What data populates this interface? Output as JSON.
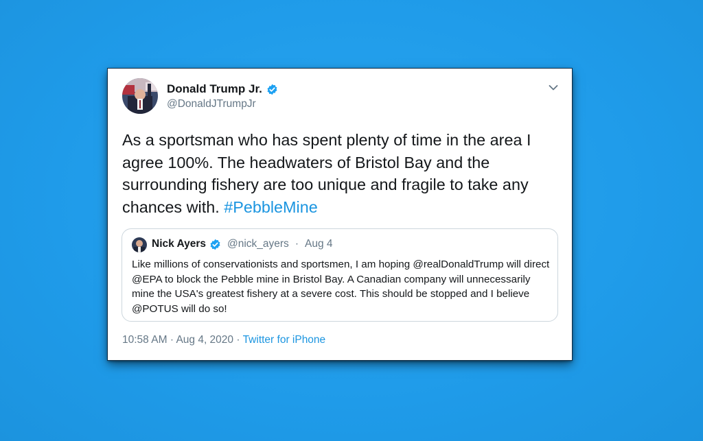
{
  "tweet": {
    "author": {
      "name": "Donald Trump Jr.",
      "handle": "@DonaldJTrumpJr",
      "verified": true
    },
    "text": "As a sportsman who has spent plenty of time in the area I agree 100%. The headwaters of Bristol Bay and the surrounding fishery are too unique and fragile to take any chances with.",
    "hashtag": "#PebbleMine",
    "quoted": {
      "name": "Nick Ayers",
      "handle": "@nick_ayers",
      "separator": "·",
      "date": "Aug 4",
      "verified": true,
      "text": "Like millions of conservationists and sportsmen, I am hoping @realDonaldTrump will direct @EPA to block the Pebble mine in Bristol Bay. A Canadian company will unnecessarily mine the USA's greatest fishery at a severe cost. This should be stopped and I believe @POTUS will do so!"
    },
    "footer": {
      "time": "10:58 AM",
      "separator": "·",
      "date": "Aug 4, 2020",
      "source": "Twitter for iPhone"
    }
  },
  "icons": {
    "verified": "verified-badge-icon",
    "caret": "chevron-down-icon"
  },
  "colors": {
    "background": "#1da1f2",
    "link": "#1b95e0",
    "text": "#14171a",
    "muted": "#657786"
  }
}
